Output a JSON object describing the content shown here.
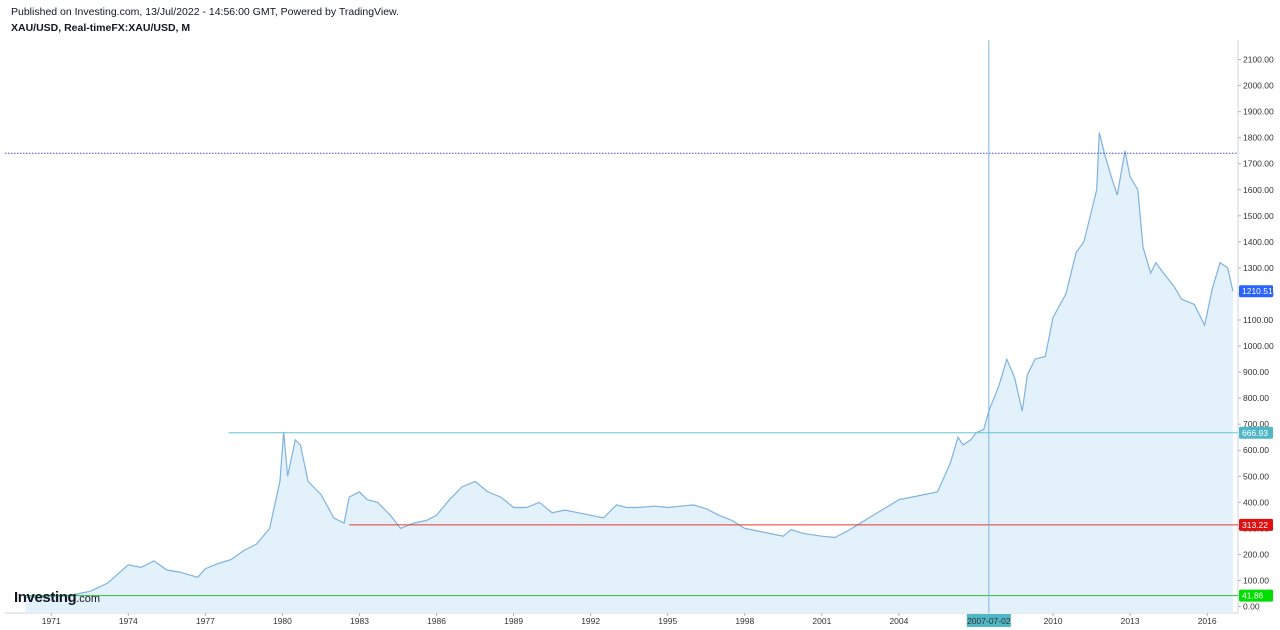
{
  "header": {
    "published": "Published on Investing.com, 13/Jul/2022 - 14:56:00 GMT, Powered by TradingView.",
    "symbol": "XAU/USD, Real-timeFX:XAU/USD, M"
  },
  "logo": {
    "main": "Investing",
    "suffix": ".com"
  },
  "chart_data": {
    "type": "area",
    "title": "",
    "xlabel": "",
    "ylabel": "",
    "ylim": [
      -25,
      2175
    ],
    "xlim": [
      1969.2,
      2017.2
    ],
    "y_ticks": [
      "0.00",
      "100.00",
      "200.00",
      "300.00",
      "400.00",
      "500.00",
      "600.00",
      "700.00",
      "800.00",
      "900.00",
      "1000.00",
      "1100.00",
      "1200.00",
      "1300.00",
      "1400.00",
      "1500.00",
      "1600.00",
      "1700.00",
      "1800.00",
      "1900.00",
      "2000.00",
      "2100.00"
    ],
    "x_ticks": [
      "1971",
      "1974",
      "1977",
      "1980",
      "1983",
      "1986",
      "1989",
      "1992",
      "1995",
      "1998",
      "2001",
      "2004",
      "2007",
      "2010",
      "2013",
      "2016"
    ],
    "series": [
      {
        "name": "",
        "color": "#7fb3e0",
        "fill": "#e3f1fb",
        "x": [
          1970.0,
          1971.0,
          1971.8,
          1972.5,
          1973.2,
          1973.6,
          1974.0,
          1974.5,
          1975.0,
          1975.5,
          1976.0,
          1976.7,
          1977.0,
          1977.5,
          1978.0,
          1978.5,
          1979.0,
          1979.5,
          1979.9,
          1980.05,
          1980.2,
          1980.5,
          1980.7,
          1981.0,
          1981.5,
          1982.0,
          1982.4,
          1982.6,
          1983.0,
          1983.3,
          1983.7,
          1984.2,
          1984.6,
          1985.1,
          1985.6,
          1986.0,
          1986.5,
          1987.0,
          1987.5,
          1988.0,
          1988.5,
          1989.0,
          1989.5,
          1990.0,
          1990.5,
          1991.0,
          1991.5,
          1992.0,
          1992.5,
          1993.0,
          1993.4,
          1993.8,
          1994.5,
          1995.0,
          1995.5,
          1996.0,
          1996.5,
          1997.0,
          1997.5,
          1998.0,
          1998.5,
          1999.0,
          1999.5,
          1999.8,
          2000.3,
          2001.0,
          2001.5,
          2002.0,
          2002.5,
          2003.0,
          2003.5,
          2004.0,
          2004.5,
          2005.0,
          2005.5,
          2006.0,
          2006.3,
          2006.5,
          2006.8,
          2007.0,
          2007.3,
          2007.5,
          2007.9,
          2008.2,
          2008.5,
          2008.8,
          2009.0,
          2009.3,
          2009.7,
          2010.0,
          2010.5,
          2010.9,
          2011.2,
          2011.5,
          2011.7,
          2011.8,
          2012.0,
          2012.3,
          2012.5,
          2012.8,
          2013.0,
          2013.3,
          2013.5,
          2013.8,
          2014.0,
          2014.3,
          2014.7,
          2015.0,
          2015.5,
          2015.9,
          2016.2,
          2016.5,
          2016.8,
          2017.0
        ],
        "values": [
          35,
          38,
          44,
          58,
          90,
          125,
          160,
          150,
          175,
          140,
          132,
          112,
          145,
          165,
          180,
          215,
          240,
          300,
          480,
          670,
          500,
          640,
          620,
          480,
          430,
          340,
          320,
          420,
          440,
          410,
          400,
          350,
          300,
          320,
          330,
          350,
          410,
          460,
          480,
          440,
          420,
          380,
          380,
          400,
          360,
          370,
          360,
          350,
          340,
          390,
          380,
          380,
          385,
          380,
          385,
          390,
          375,
          350,
          330,
          300,
          290,
          280,
          270,
          295,
          280,
          270,
          265,
          290,
          320,
          350,
          380,
          410,
          420,
          430,
          440,
          550,
          650,
          620,
          640,
          667,
          680,
          750,
          850,
          950,
          880,
          750,
          890,
          950,
          960,
          1110,
          1200,
          1360,
          1400,
          1520,
          1600,
          1820,
          1740,
          1640,
          1580,
          1750,
          1650,
          1600,
          1380,
          1280,
          1320,
          1280,
          1230,
          1180,
          1160,
          1080,
          1220,
          1320,
          1300,
          1210.51
        ]
      }
    ],
    "horizontal_lines": [
      {
        "value": 1740,
        "color": "#3355cc",
        "style": "dotted",
        "x_start": 1969.2
      },
      {
        "value": 666.93,
        "color": "#66c7d6",
        "style": "solid",
        "x_start": 1977.9
      },
      {
        "value": 313.22,
        "color": "#e53935",
        "style": "solid",
        "x_start": 1982.6
      },
      {
        "value": 41.86,
        "color": "#33bb33",
        "style": "solid",
        "x_start": 1970.0
      }
    ],
    "vertical_line": {
      "x": 2007.5,
      "color": "#7fb3e0"
    },
    "badges": [
      {
        "label": "1210.51",
        "value": 1210.51,
        "color": "#2962ff"
      },
      {
        "label": "666.93",
        "value": 666.93,
        "color": "#4fb6c6"
      },
      {
        "label": "313.22",
        "value": 313.22,
        "color": "#e01010"
      },
      {
        "label": "41.86",
        "value": 41.86,
        "color": "#00dd00"
      }
    ],
    "x_badge": {
      "label": "2007-07-02",
      "x": 2007.5,
      "color": "#4fb6c6"
    }
  }
}
